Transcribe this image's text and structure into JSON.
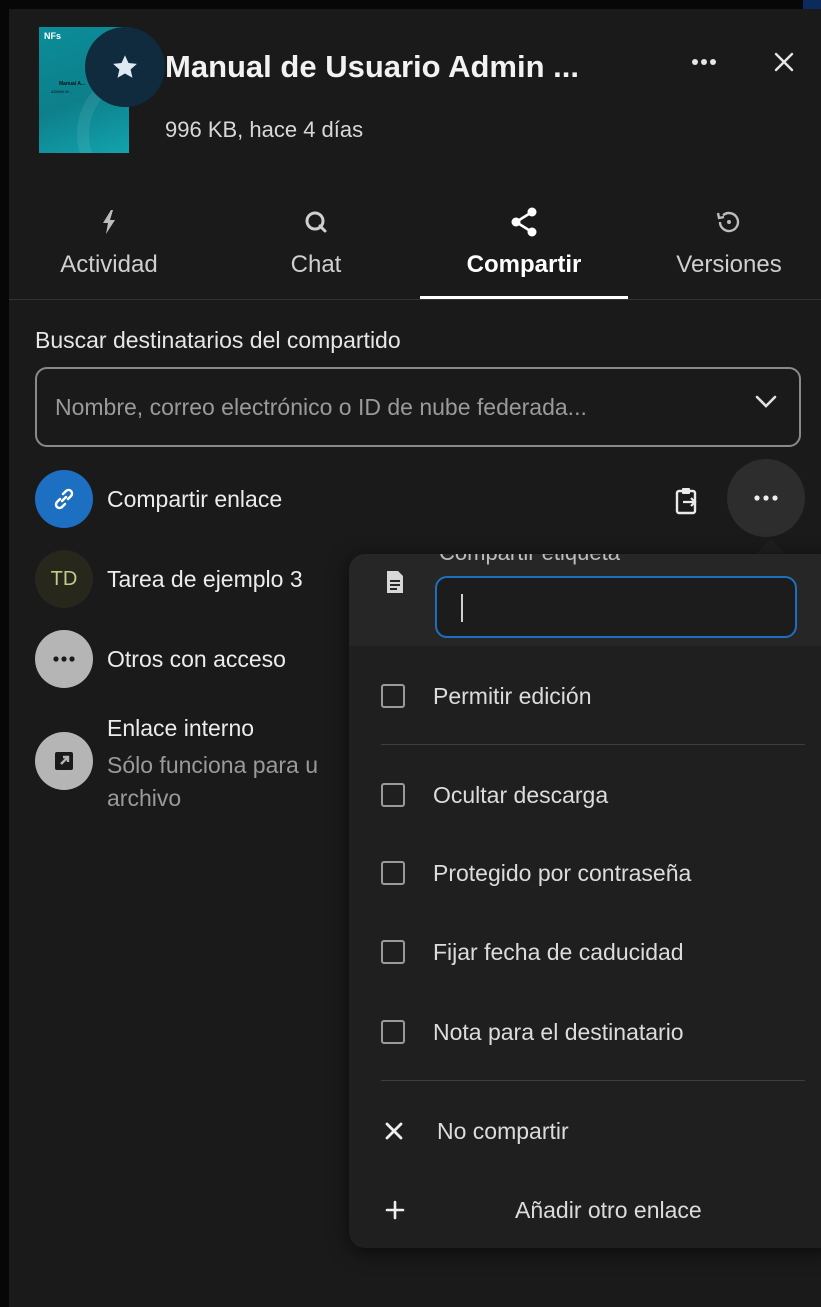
{
  "file": {
    "title": "Manual de Usuario Admin ...",
    "meta": "996 KB, hace 4 días",
    "thumbnail_logo": "NFs",
    "thumbnail_title": "Manual A...",
    "thumbnail_sub": "ADMIN W ..."
  },
  "tabs": [
    {
      "label": "Actividad",
      "icon": "lightning-icon"
    },
    {
      "label": "Chat",
      "icon": "chat-icon"
    },
    {
      "label": "Compartir",
      "icon": "share-icon",
      "active": true
    },
    {
      "label": "Versiones",
      "icon": "history-icon"
    }
  ],
  "search": {
    "label": "Buscar destinatarios del compartido",
    "placeholder": "Nombre, correo electrónico o ID de nube federada..."
  },
  "shares": {
    "link_label": "Compartir enlace",
    "user_initials": "TD",
    "user_label": "Tarea de ejemplo 3",
    "others_label": "Otros con acceso",
    "internal_label": "Enlace interno",
    "internal_sub": "Sólo funciona para u archivo"
  },
  "menu": {
    "label_header_cut": "Compartir etiqueta",
    "label_value": "",
    "options": [
      {
        "label": "Permitir edición",
        "checked": false
      },
      {
        "label": "Ocultar descarga",
        "checked": false
      },
      {
        "label": "Protegido por contraseña",
        "checked": false
      },
      {
        "label": "Fijar fecha de caducidad",
        "checked": false
      },
      {
        "label": "Nota para el destinatario",
        "checked": false
      }
    ],
    "unshare_label": "No compartir",
    "add_link_label": "Añadir otro enlace"
  },
  "colors": {
    "background": "#1a1a1a",
    "accent": "#1d6fc1",
    "thumbnail": "#0d7f8a"
  }
}
